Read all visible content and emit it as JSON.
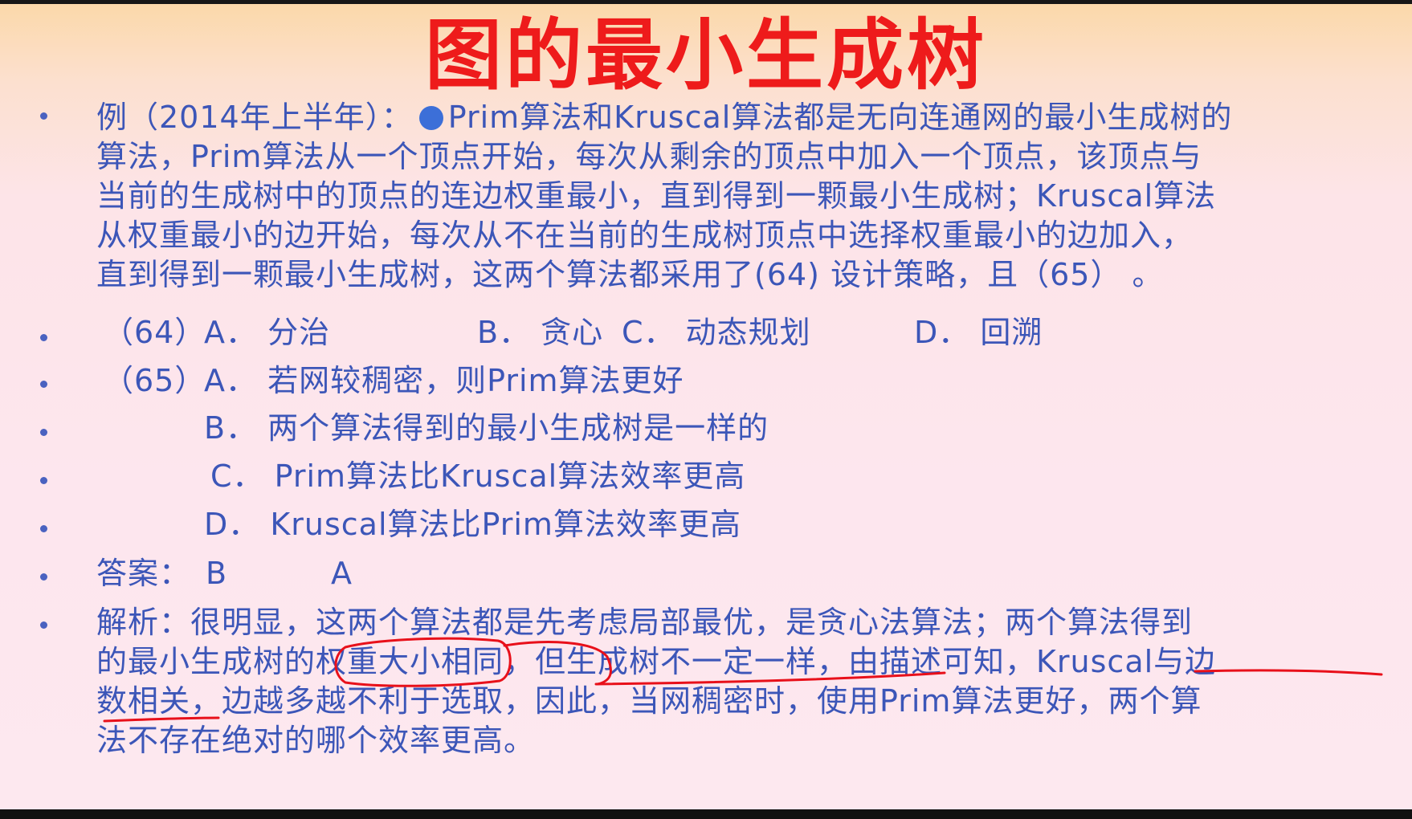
{
  "title": "图的最小生成树",
  "question": {
    "prefix": "例（2014年上半年）：",
    "lines": [
      "Prim算法和Kruscal算法都是无向连通网的最小生成树的",
      "算法，Prim算法从一个顶点开始，每次从剩余的顶点中加入一个顶点，该顶点与",
      "当前的生成树中的顶点的连边权重最小，直到得到一颗最小生成树；Kruscal算法",
      "从权重最小的边开始，每次从不在当前的生成树顶点中选择权重最小的边加入，",
      "直到得到一颗最小生成树，这两个算法都采用了(64) 设计策略，且（65）  。"
    ]
  },
  "q64": {
    "label": "（64）",
    "a": "A． 分治",
    "b": "B． 贪心",
    "c": "C． 动态规划",
    "d": "D． 回溯"
  },
  "q65": {
    "label": "（65）",
    "a": "A． 若网较稠密，则Prim算法更好",
    "b": "B． 两个算法得到的最小生成树是一样的",
    "c": "C． Prim算法比Kruscal算法效率更高",
    "d": "D． Kruscal算法比Prim算法效率更高"
  },
  "answer": {
    "label": "答案：",
    "first": "B",
    "second": "A"
  },
  "analysis": {
    "lines": [
      "解析：很明显，这两个算法都是先考虑局部最优，是贪心法算法；两个算法得到",
      "的最小生成树的权重大小相同，但生成树不一定一样，由描述可知，Kruscal与边",
      "数相关，边越多越不利于选取，因此，当网稠密时，使用Prim算法更好，两个算",
      "法不存在绝对的哪个效率更高。"
    ]
  },
  "colors": {
    "title": "#ee1b1b",
    "body_text": "#3c56b8",
    "annotation_ink": "#e8101a",
    "marker": "#3c6fd8"
  }
}
